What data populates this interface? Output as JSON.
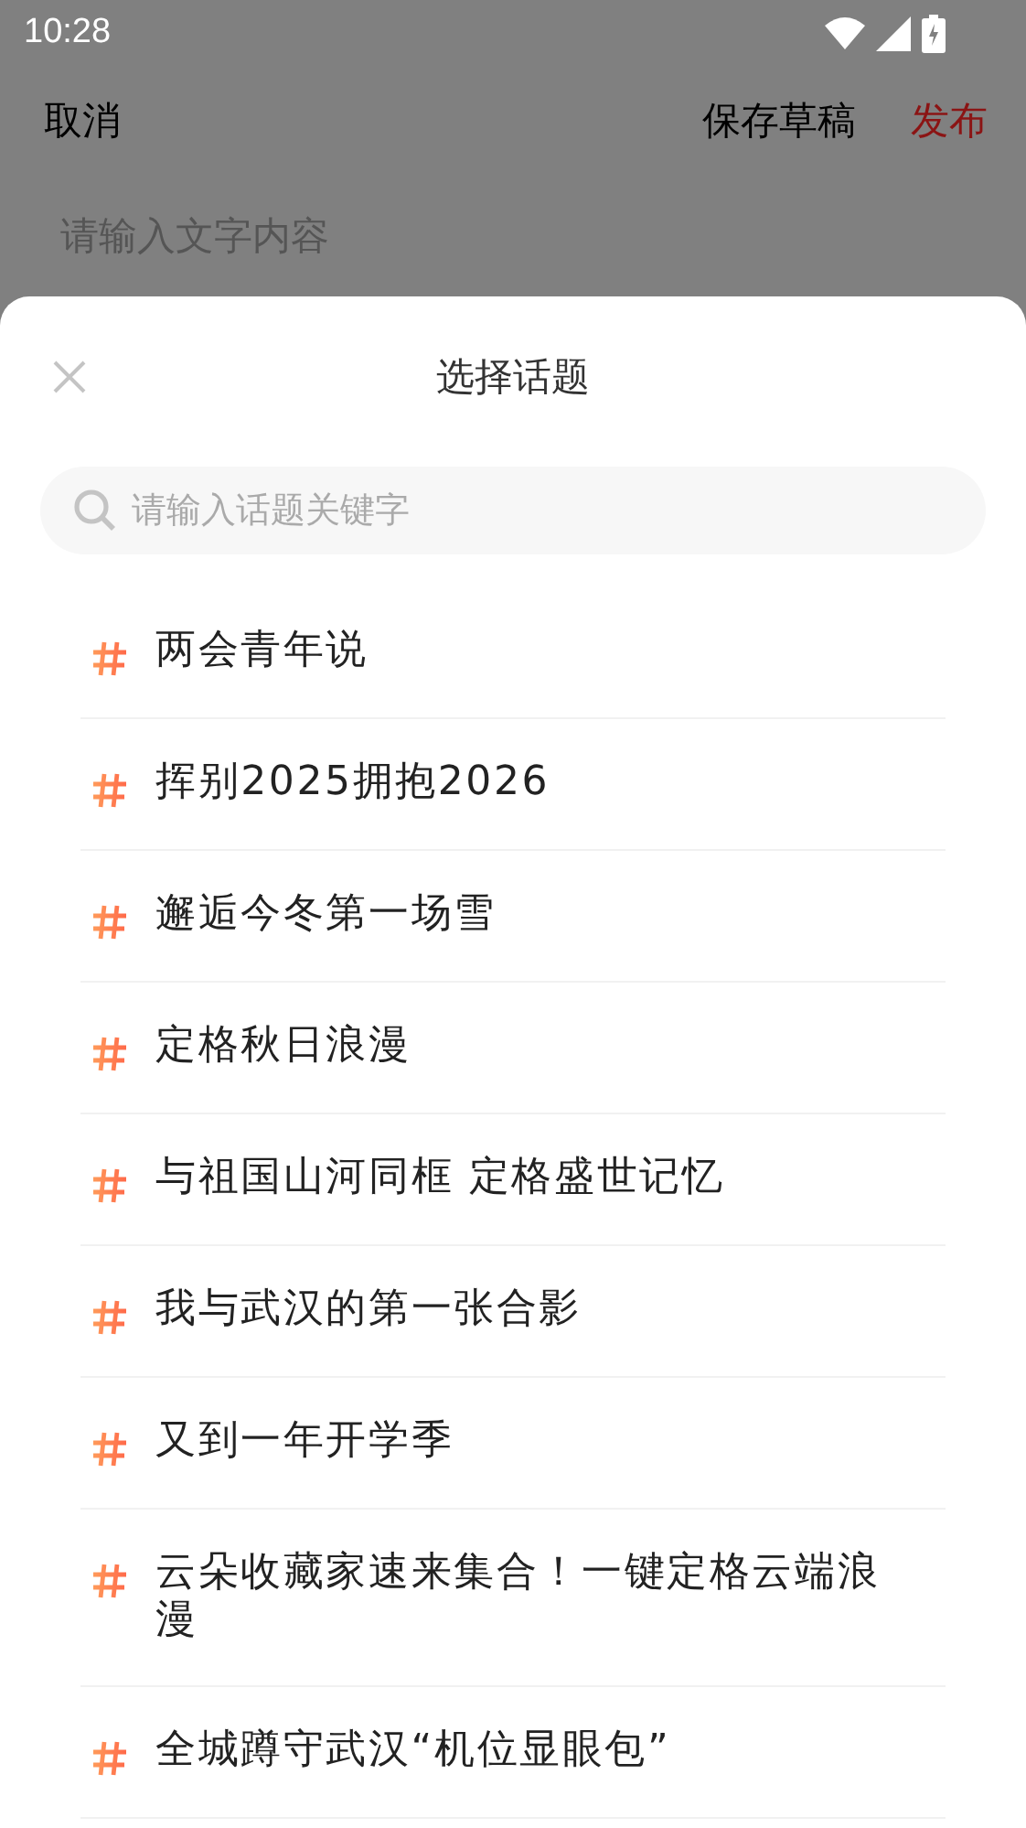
{
  "status_bar": {
    "time": "10:28"
  },
  "editor": {
    "cancel": "取消",
    "save_draft": "保存草稿",
    "publish": "发布",
    "placeholder": "请输入文字内容"
  },
  "sheet": {
    "title": "选择话题",
    "search": {
      "placeholder": "请输入话题关键字"
    },
    "topics": [
      {
        "label": "两会青年说"
      },
      {
        "label": "挥别2025拥抱2026"
      },
      {
        "label": "邂逅今冬第一场雪"
      },
      {
        "label": "定格秋日浪漫"
      },
      {
        "label": "与祖国山河同框 定格盛世记忆"
      },
      {
        "label": "我与武汉的第一张合影"
      },
      {
        "label": "又到一年开学季"
      },
      {
        "label": "云朵收藏家速来集合！一键定格云端浪漫"
      },
      {
        "label": "全城蹲守武汉“机位显眼包”"
      }
    ]
  }
}
